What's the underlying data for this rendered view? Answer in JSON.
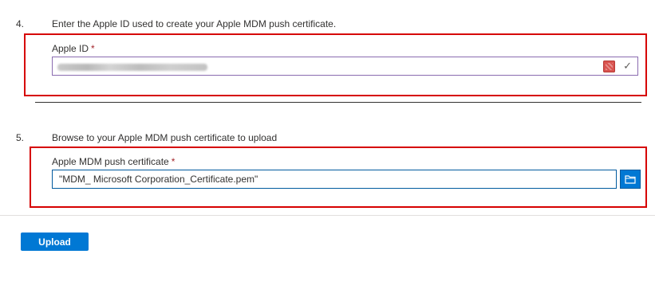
{
  "steps": [
    {
      "number": "4.",
      "text": "Enter the Apple ID used to create your Apple MDM push certificate.",
      "field_label": "Apple ID",
      "required_marker": "*",
      "value": ""
    },
    {
      "number": "5.",
      "text": "Browse to your Apple MDM push certificate to upload",
      "field_label": "Apple MDM push certificate",
      "required_marker": "*",
      "value": "\"MDM_ Microsoft Corporation_Certificate.pem\""
    }
  ],
  "icons": {
    "autofill": "password-manager-icon",
    "validation": "checkmark-icon",
    "browse": "folder-icon"
  },
  "actions": {
    "upload_label": "Upload"
  },
  "colors": {
    "highlight_box": "#d60000",
    "primary": "#0078d4",
    "required": "#a4262c",
    "apple_input_border": "#8a6bb0"
  }
}
